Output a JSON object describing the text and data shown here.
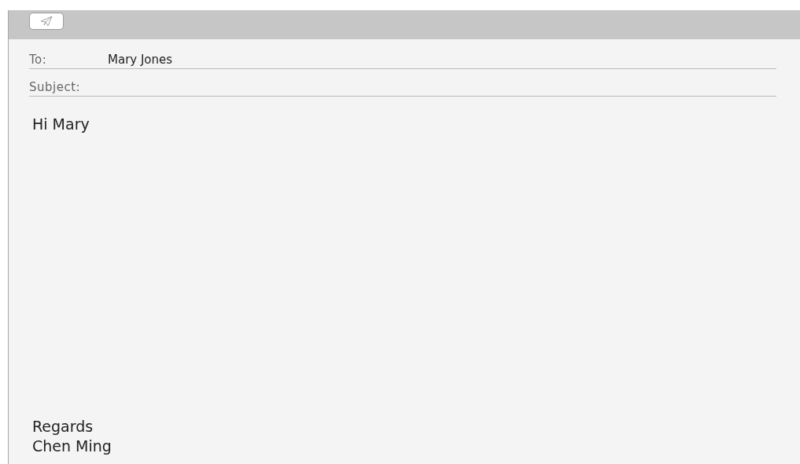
{
  "fields": [
    {
      "label": "To:",
      "value": "Mary Jones"
    },
    {
      "label": "Subject:"
    }
  ],
  "body": {
    "greeting": "Hi Mary",
    "signature": [
      "Regards",
      "Chen Ming"
    ]
  }
}
